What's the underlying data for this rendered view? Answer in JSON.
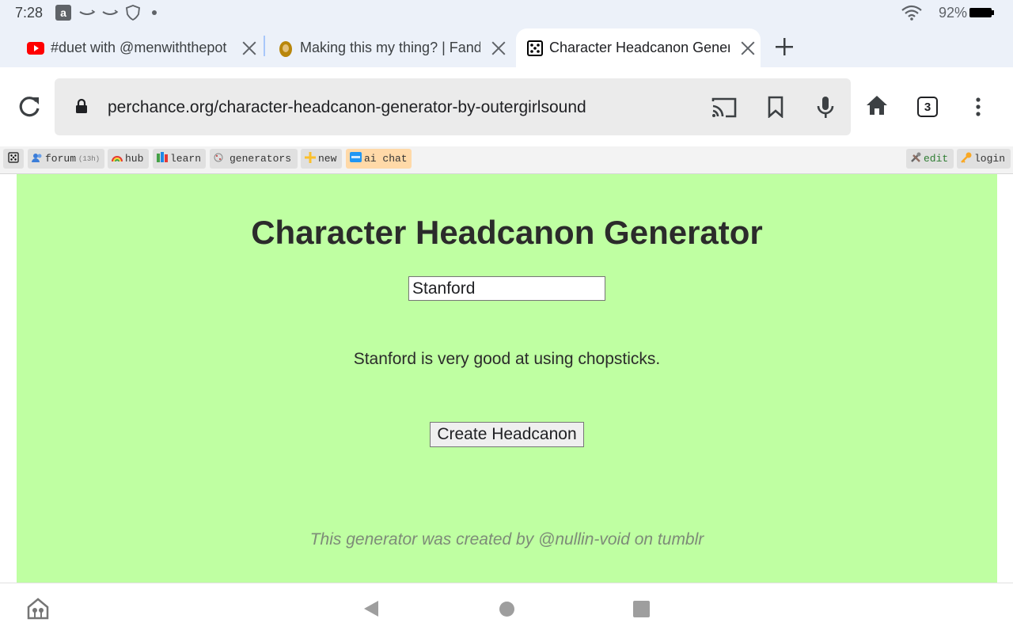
{
  "status_bar": {
    "time": "7:28",
    "battery_percent": "92%",
    "icons": [
      "amazon-icon",
      "amazon-smile-icon",
      "amazon-smile-icon",
      "shield-icon",
      "dot-icon",
      "wifi-icon",
      "battery-icon"
    ]
  },
  "tabs": [
    {
      "title": "#duet with @menwiththepot",
      "icon": "youtube-icon",
      "active": false
    },
    {
      "title": "Making this my thing? | Fandom",
      "icon": "fandom-avatar-icon",
      "active": false
    },
    {
      "title": "Character Headcanon Generator",
      "icon": "dice-icon",
      "active": true
    }
  ],
  "toolbar": {
    "url": "perchance.org/character-headcanon-generator-by-outergirlsound",
    "tab_count": "3"
  },
  "perchance_bar": {
    "forum": "forum",
    "forum_badge": "(13h)",
    "hub": "hub",
    "learn": "learn",
    "generators": "generators",
    "new": "new",
    "ai_chat": "ai chat",
    "edit": "edit",
    "login": "login"
  },
  "generator": {
    "title": "Character Headcanon Generator",
    "name_value": "Stanford",
    "result": "Stanford is very good at using chopsticks.",
    "button_label": "Create Headcanon",
    "credit": "This generator was created by @nullin-void on tumblr"
  },
  "colors": {
    "page_background": "#bfffa2",
    "chrome_background": "#ecf1f9",
    "omnibox": "#ebebeb"
  }
}
